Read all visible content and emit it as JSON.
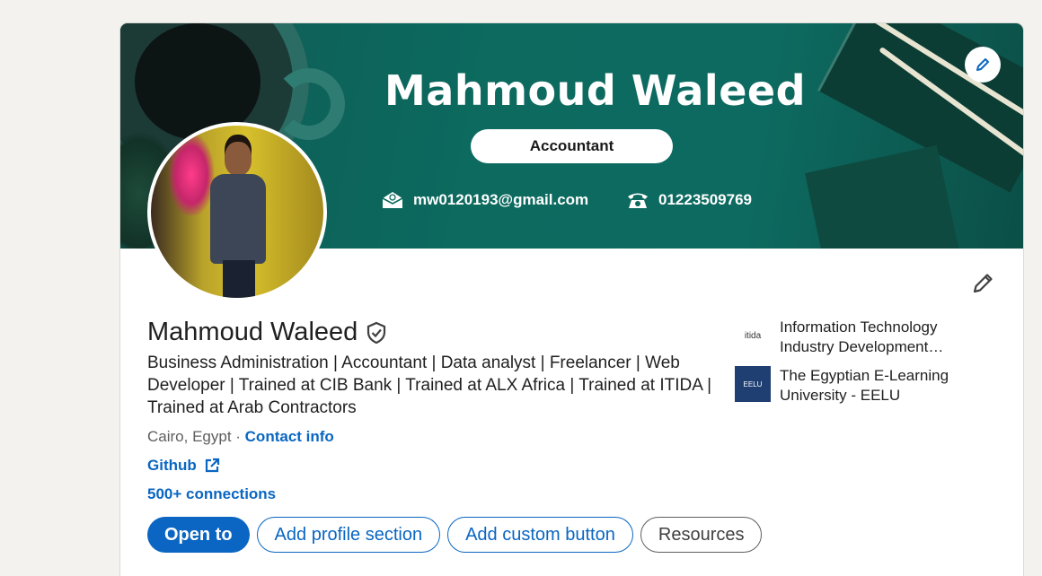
{
  "banner": {
    "name": "Mahmoud Waleed",
    "title_pill": "Accountant",
    "email": "mw0120193@gmail.com",
    "phone": "01223509769"
  },
  "profile": {
    "name": "Mahmoud Waleed",
    "headline": "Business Administration | Accountant | Data analyst | Freelancer | Web Developer | Trained at CIB Bank | Trained at ALX Africa | Trained at ITIDA | Trained at Arab Contractors",
    "location": "Cairo, Egypt",
    "separator": " · ",
    "contact_info_label": "Contact info",
    "github_label": "Github",
    "connections": "500+ connections"
  },
  "actions": {
    "open_to": "Open to",
    "add_profile_section": "Add profile section",
    "add_custom_button": "Add custom button",
    "resources": "Resources"
  },
  "organizations": [
    {
      "name_line1": "Information Technology",
      "name_line2": "Industry Development…",
      "logo_text": "itida"
    },
    {
      "name_line1": "The Egyptian E-Learning",
      "name_line2": "University - EELU",
      "logo_text": "EELU"
    }
  ],
  "colors": {
    "brand_blue": "#0a66c2",
    "banner_teal": "#0c6a5f",
    "page_bg": "#f4f2ee"
  },
  "icons": {
    "verified": "shield-check-icon",
    "edit": "pencil-icon",
    "external_link": "external-link-icon",
    "email": "envelope-icon",
    "phone": "telephone-icon"
  }
}
